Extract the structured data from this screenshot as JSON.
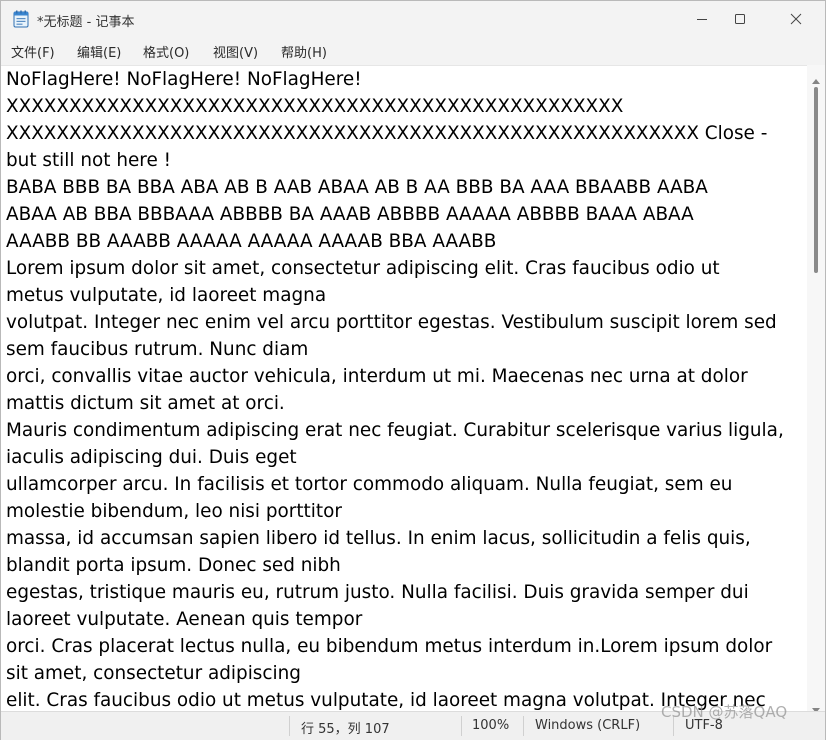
{
  "window": {
    "title": "*无标题 - 记事本"
  },
  "menu": [
    {
      "label": "文件(F)"
    },
    {
      "label": "编辑(E)"
    },
    {
      "label": "格式(O)"
    },
    {
      "label": "视图(V)"
    },
    {
      "label": "帮助(H)"
    }
  ],
  "editor": {
    "lines": [
      "NoFlagHere! NoFlagHere! NoFlagHere!",
      "XXXXXXXXXXXXXXXXXXXXXXXXXXXXXXXXXXXXXXXXXXXXXXXXX",
      "XXXXXXXXXXXXXXXXXXXXXXXXXXXXXXXXXXXXXXXXXXXXXXXXXXXXXXX Close -",
      "but still not here !",
      "BABA BBB BA BBA ABA AB B AAB ABAA AB B AA BBB BA AAA BBAABB AABA",
      "ABAA AB BBA BBBAAA ABBBB BA AAAB ABBBB AAAAA ABBBB BAAA ABAA",
      "AAABB BB AAABB AAAAA AAAAA AAAAB BBA AAABB",
      "Lorem ipsum dolor sit amet, consectetur adipiscing elit. Cras faucibus odio ut",
      "metus vulputate, id laoreet magna",
      "volutpat. Integer nec enim vel arcu porttitor egestas. Vestibulum suscipit lorem sed",
      "sem faucibus rutrum. Nunc diam",
      "orci, convallis vitae auctor vehicula, interdum ut mi. Maecenas nec urna at dolor",
      "mattis dictum sit amet at orci.",
      "Mauris condimentum adipiscing erat nec feugiat. Curabitur scelerisque varius ligula,",
      "iaculis adipiscing dui. Duis eget",
      "ullamcorper arcu. In facilisis et tortor commodo aliquam. Nulla feugiat, sem eu",
      "molestie bibendum, leo nisi porttitor",
      "massa, id accumsan sapien libero id tellus. In enim lacus, sollicitudin a felis quis,",
      "blandit porta ipsum. Donec sed nibh",
      "egestas, tristique mauris eu, rutrum justo. Nulla facilisi. Duis gravida semper dui",
      "laoreet vulputate. Aenean quis tempor",
      "orci. Cras placerat lectus nulla, eu bibendum metus interdum in.Lorem ipsum dolor",
      "sit amet, consectetur adipiscing",
      "elit. Cras faucibus odio ut metus vulputate, id laoreet magna volutpat. Integer nec"
    ]
  },
  "status": {
    "position": "行 55，列 107",
    "zoom": "100%",
    "line_ending": "Windows (CRLF)",
    "encoding": "UTF-8"
  },
  "watermark": "CSDN @苏落QAQ",
  "colors": {
    "window_bg": "#f3f3f3",
    "editor_bg": "#ffffff",
    "text": "#000000"
  }
}
